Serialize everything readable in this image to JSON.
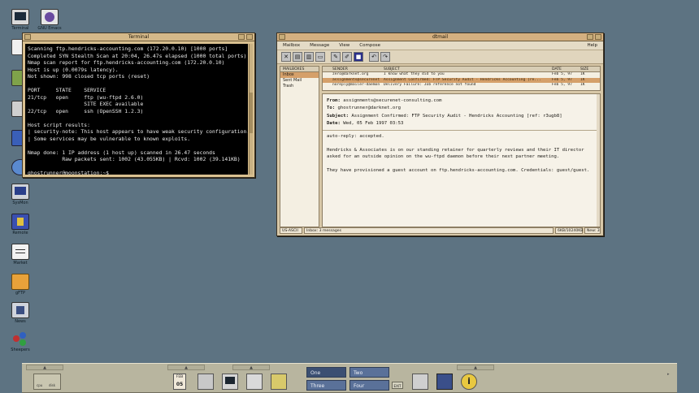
{
  "desktop": {
    "icons": [
      {
        "label": "Terminal"
      },
      {
        "label": "GNU Emacs"
      },
      {
        "label": "SysMon"
      },
      {
        "label": "Remote"
      },
      {
        "label": "Market"
      },
      {
        "label": "gFTP"
      },
      {
        "label": "News"
      },
      {
        "label": "Sheepers"
      }
    ]
  },
  "terminal": {
    "title": "Terminal",
    "lines": [
      "Scanning ftp.hendricks-accounting.com (172.20.0.10) [1000 ports]",
      "Completed SYN Stealth Scan at 20:04, 26.47s elapsed (1000 total ports)",
      "Nmap scan report for ftp.hendricks-accounting.com (172.20.0.10)",
      "Host is up (0.0079s latency).",
      "Not shown: 998 closed tcp ports (reset)",
      "",
      "PORT     STATE    SERVICE",
      "21/tcp   open     ftp (wu-ftpd 2.6.0)",
      "                  SITE EXEC available",
      "22/tcp   open     ssh (OpenSSH 1.2.3)",
      "",
      "Host script results:",
      "| security-note: This host appears to have weak security configuration.",
      "| Some services may be vulnerable to known exploits.",
      "",
      "Nmap done: 1 IP address (1 host up) scanned in 26.47 seconds",
      "           Raw packets sent: 1002 (43.055KB) | Rcvd: 1002 (39.141KB)",
      "",
      "ghostrunner@moonstation:~$"
    ]
  },
  "mail": {
    "title": "dtmail",
    "menu": [
      "Mailbox",
      "Message",
      "View",
      "Compose"
    ],
    "help": "Help",
    "mailboxes_header": "MAILBOXES",
    "mailboxes": [
      "Inbox",
      "Sent Mail",
      "Trash"
    ],
    "columns": {
      "sender": "SENDER",
      "subject": "SUBJECT",
      "date": "DATE",
      "size": "SIZE"
    },
    "messages": [
      {
        "sender": "zero@darknet.org",
        "subject": "I know what they did to you",
        "date": "Feb 5, 97",
        "size": "1K"
      },
      {
        "sender": "assignments@securenet...",
        "subject": "Assignment Confirmed: FTP Security Audit - Hendricks Accounting [re...",
        "date": "Feb 5, 97",
        "size": "1K"
      },
      {
        "sender": "noreply@mailer-daemon...",
        "subject": "Delivery Failure: Job reference not found",
        "date": "Feb 5, 97",
        "size": "1K"
      }
    ],
    "open_message": {
      "from_label": "From:",
      "from": "assignments@securenet-consulting.com",
      "to_label": "To:",
      "to": "ghostrunner@darknet.org",
      "subject_label": "Subject:",
      "subject": "Assignment Confirmed: FTP Security Audit - Hendricks Accounting [ref: r3ugb8]",
      "date_label": "Date:",
      "date": "Wed, 05 Feb 1997 03:53",
      "body": [
        "auto-reply: accepted.",
        "Hendricks & Associates is on our standing retainer for quarterly reviews and their IT director\nasked for an outside opinion on the wu-ftpd daemon before their next partner meeting.",
        "They have provisioned a guest account on ftp.hendricks-accounting.com. Credentials: guest/guest."
      ]
    },
    "status": {
      "encoding": "US-ASCII",
      "count": "Inbox: 3 messages",
      "size": "6KB/10240KB",
      "new": "New: 3"
    }
  },
  "panel": {
    "calendar": {
      "month": "FEB",
      "day": "05"
    },
    "workspaces": [
      "One",
      "Two",
      "Three",
      "Four"
    ],
    "exit": "EXIT",
    "mini_labels": [
      "cpu",
      "disk"
    ]
  }
}
